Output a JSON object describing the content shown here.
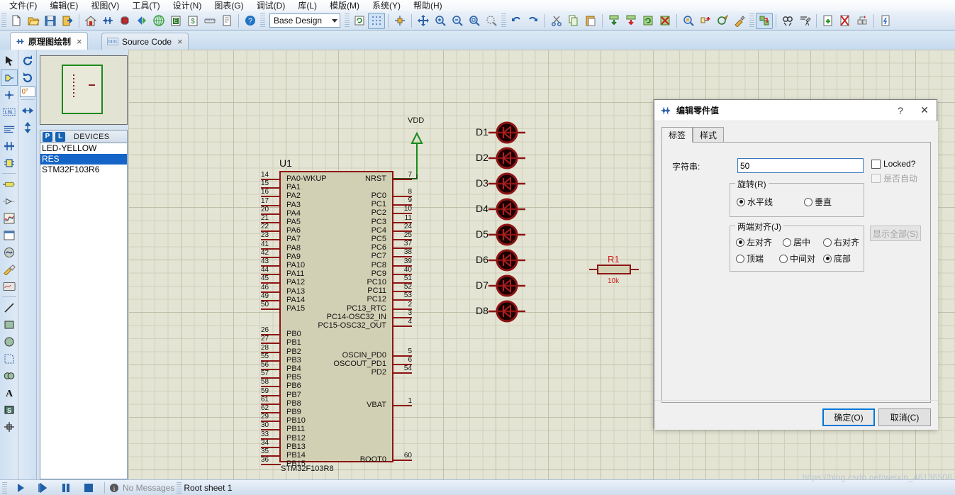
{
  "menu": {
    "items": [
      "文件(F)",
      "编辑(E)",
      "视图(V)",
      "工具(T)",
      "设计(N)",
      "图表(G)",
      "调试(D)",
      "库(L)",
      "模版(M)",
      "系统(Y)",
      "帮助(H)"
    ]
  },
  "toolbar": {
    "design_combo_value": "Base Design",
    "icons": [
      "new-file-icon",
      "open-folder-icon",
      "save-icon",
      "export-icon",
      "home-icon",
      "schematic-icon",
      "pcb-chip-icon",
      "3d-view-icon",
      "bom-icon",
      "netlist-icon",
      "bill-icon",
      "ruler-icon",
      "report-icon",
      "help-icon",
      "refresh-grid-icon",
      "grid-toggle-icon",
      "origin-icon",
      "pan-icon",
      "zoom-in-icon",
      "zoom-out-icon",
      "zoom-all-icon",
      "zoom-area-icon",
      "undo-icon",
      "redo-icon",
      "cut-icon",
      "copy-icon",
      "paste-icon",
      "block-copy-icon",
      "block-move-icon",
      "block-rotate-icon",
      "block-delete-icon",
      "pick-device-icon",
      "make-device-icon",
      "packaging-tool-icon",
      "decompose-icon",
      "wire-autorouter-icon",
      "search-tag-icon",
      "property-assign-icon",
      "new-sheet-icon",
      "remove-sheet-icon",
      "goto-sheet-icon",
      "bill-of-materials-icon"
    ]
  },
  "tabs": [
    {
      "label": "原理图绘制",
      "icon": "schematic-icon",
      "active": true,
      "close": "×"
    },
    {
      "label": "Source Code",
      "icon": "code-icon",
      "active": false,
      "close": "×"
    }
  ],
  "left_toolbox": {
    "col1": [
      "selection-icon",
      "component-mode-icon",
      "junction-dot-icon",
      "wire-label-icon",
      "text-script-icon",
      "bus-icon",
      "subcircuit-icon",
      "terminal-icon",
      "device-pin-icon",
      "graph-icon",
      "tape-recorder-icon",
      "generator-icon",
      "voltage-probe-icon",
      "current-probe-icon",
      "virtual-instrument-icon",
      "line-icon",
      "box-icon",
      "circle-icon",
      "arc-icon",
      "path-icon",
      "text-icon",
      "symbol-icon",
      "marker-icon"
    ],
    "col2": [
      "rotate-cw-icon",
      "rotate-ccw-icon",
      "rotation-field",
      "mirror-horizontal-icon",
      "mirror-vertical-icon"
    ],
    "rotation_value": "0°"
  },
  "devices_panel": {
    "p_label": "P",
    "l_label": "L",
    "title": "DEVICES",
    "items": [
      "LED-YELLOW",
      "RES",
      "STM32F103R6"
    ],
    "selected": "RES"
  },
  "schematic": {
    "chip": {
      "ref": "U1",
      "part": "STM32F103R8",
      "left_pins": [
        {
          "num": "14",
          "name": "PA0-WKUP"
        },
        {
          "num": "15",
          "name": "PA1"
        },
        {
          "num": "16",
          "name": "PA2"
        },
        {
          "num": "17",
          "name": "PA3"
        },
        {
          "num": "20",
          "name": "PA4"
        },
        {
          "num": "21",
          "name": "PA5"
        },
        {
          "num": "22",
          "name": "PA6"
        },
        {
          "num": "23",
          "name": "PA7"
        },
        {
          "num": "41",
          "name": "PA8"
        },
        {
          "num": "42",
          "name": "PA9"
        },
        {
          "num": "43",
          "name": "PA10"
        },
        {
          "num": "44",
          "name": "PA11"
        },
        {
          "num": "45",
          "name": "PA12"
        },
        {
          "num": "46",
          "name": "PA13"
        },
        {
          "num": "49",
          "name": "PA14"
        },
        {
          "num": "50",
          "name": "PA15"
        },
        {
          "num": "26",
          "name": "PB0"
        },
        {
          "num": "27",
          "name": "PB1"
        },
        {
          "num": "28",
          "name": "PB2"
        },
        {
          "num": "55",
          "name": "PB3"
        },
        {
          "num": "56",
          "name": "PB4"
        },
        {
          "num": "57",
          "name": "PB5"
        },
        {
          "num": "58",
          "name": "PB6"
        },
        {
          "num": "59",
          "name": "PB7"
        },
        {
          "num": "61",
          "name": "PB8"
        },
        {
          "num": "62",
          "name": "PB9"
        },
        {
          "num": "29",
          "name": "PB10"
        },
        {
          "num": "30",
          "name": "PB11"
        },
        {
          "num": "33",
          "name": "PB12"
        },
        {
          "num": "34",
          "name": "PB13"
        },
        {
          "num": "35",
          "name": "PB14"
        },
        {
          "num": "36",
          "name": "PB15"
        }
      ],
      "right_pins": [
        {
          "num": "7",
          "name": "NRST"
        },
        {
          "num": "8",
          "name": "PC0"
        },
        {
          "num": "9",
          "name": "PC1"
        },
        {
          "num": "10",
          "name": "PC2"
        },
        {
          "num": "11",
          "name": "PC3"
        },
        {
          "num": "24",
          "name": "PC4"
        },
        {
          "num": "25",
          "name": "PC5"
        },
        {
          "num": "37",
          "name": "PC6"
        },
        {
          "num": "38",
          "name": "PC7"
        },
        {
          "num": "39",
          "name": "PC8"
        },
        {
          "num": "40",
          "name": "PC9"
        },
        {
          "num": "51",
          "name": "PC10"
        },
        {
          "num": "52",
          "name": "PC11"
        },
        {
          "num": "53",
          "name": "PC12"
        },
        {
          "num": "2",
          "name": "PC13_RTC"
        },
        {
          "num": "3",
          "name": "PC14-OSC32_IN"
        },
        {
          "num": "4",
          "name": "PC15-OSC32_OUT"
        },
        {
          "num": "5",
          "name": "OSCIN_PD0"
        },
        {
          "num": "6",
          "name": "OSCOUT_PD1"
        },
        {
          "num": "54",
          "name": "PD2"
        },
        {
          "num": "1",
          "name": "VBAT"
        },
        {
          "num": "60",
          "name": "BOOT0"
        }
      ]
    },
    "power_label": "VDD",
    "leds": [
      "D1",
      "D2",
      "D3",
      "D4",
      "D5",
      "D6",
      "D7",
      "D8"
    ],
    "resistor": {
      "ref": "R1",
      "value": "10k"
    }
  },
  "dialog": {
    "title": "编辑零件值",
    "icon": "component-icon",
    "help_btn": "?",
    "close_btn": "✕",
    "tabs": [
      {
        "label": "标签",
        "active": true
      },
      {
        "label": "样式",
        "active": false
      }
    ],
    "string_label": "字符串:",
    "string_value": "50",
    "rotation_group": "旋转(R)",
    "rotation_options": [
      {
        "label": "水平线",
        "selected": true
      },
      {
        "label": "垂直",
        "selected": false
      }
    ],
    "justify_group": "两端对齐(J)",
    "justify_options": [
      {
        "label": "左对齐",
        "selected": true
      },
      {
        "label": "居中",
        "selected": false
      },
      {
        "label": "右对齐",
        "selected": false
      },
      {
        "label": "顶端",
        "selected": false
      },
      {
        "label": "中间对",
        "selected": false
      },
      {
        "label": "底部",
        "selected": true
      }
    ],
    "locked_label": "Locked?",
    "locked_checked": false,
    "auto_label": "是否自动",
    "auto_checked": false,
    "auto_disabled": true,
    "show_all_label": "显示全部(S)",
    "ok_label": "确定(O)",
    "cancel_label": "取消(C)"
  },
  "statusbar": {
    "play_icon": "play-icon",
    "step_icon": "step-icon",
    "pause_icon": "pause-icon",
    "stop_icon": "stop-icon",
    "message_icon": "info-icon",
    "message": "No Messages",
    "sheet": "Root sheet 1"
  },
  "watermark": "https://blog.csdn.net/weixin_46136508"
}
